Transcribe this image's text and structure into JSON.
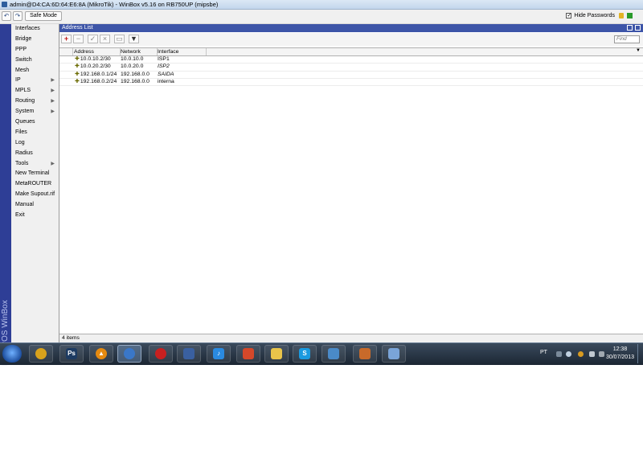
{
  "window": {
    "title": "admin@D4:CA:6D:64:E6:8A (MikroTik) - WinBox v5.16 on RB750UP (mipsbe)"
  },
  "toolbar": {
    "undo_icon": "undo-icon",
    "redo_icon": "redo-icon",
    "safe_mode_label": "Safe Mode",
    "hide_passwords_label": "Hide Passwords",
    "hide_passwords_checked": true
  },
  "sidebar": {
    "brand": "RouterOS WinBox",
    "items": [
      {
        "label": "Interfaces",
        "submenu": false
      },
      {
        "label": "Bridge",
        "submenu": false
      },
      {
        "label": "PPP",
        "submenu": false
      },
      {
        "label": "Switch",
        "submenu": false
      },
      {
        "label": "Mesh",
        "submenu": false
      },
      {
        "label": "IP",
        "submenu": true
      },
      {
        "label": "MPLS",
        "submenu": true
      },
      {
        "label": "Routing",
        "submenu": true
      },
      {
        "label": "System",
        "submenu": true
      },
      {
        "label": "Queues",
        "submenu": false
      },
      {
        "label": "Files",
        "submenu": false
      },
      {
        "label": "Log",
        "submenu": false
      },
      {
        "label": "Radius",
        "submenu": false
      },
      {
        "label": "Tools",
        "submenu": true
      },
      {
        "label": "New Terminal",
        "submenu": false
      },
      {
        "label": "MetaROUTER",
        "submenu": false
      },
      {
        "label": "Make Supout.rif",
        "submenu": false
      },
      {
        "label": "Manual",
        "submenu": false
      },
      {
        "label": "Exit",
        "submenu": false
      }
    ]
  },
  "address_list": {
    "title": "Address List",
    "find_placeholder": "Find",
    "columns": [
      "Address",
      "Network",
      "Interface"
    ],
    "rows": [
      {
        "address": "10.0.10.2/30",
        "network": "10.0.10.0",
        "interface": "ISP1",
        "italic": false
      },
      {
        "address": "10.0.20.2/30",
        "network": "10.0.20.0",
        "interface": "ISP2",
        "italic": true
      },
      {
        "address": "192.168.0.1/24",
        "network": "192.168.0.0",
        "interface": "SAIDA",
        "italic": true
      },
      {
        "address": "192.168.0.2/24",
        "network": "192.168.0.0",
        "interface": "interna",
        "italic": false
      }
    ],
    "status": "4 items"
  },
  "taskbar": {
    "apps": [
      {
        "name": "chrome-icon",
        "glyph": "",
        "color": "#d8a21c"
      },
      {
        "name": "photoshop-icon",
        "glyph": "Ps",
        "color": "#1d3b62"
      },
      {
        "name": "vlc-icon",
        "glyph": "▲",
        "color": "#e58a10"
      },
      {
        "name": "winbox-icon",
        "glyph": "",
        "color": "#3a77c8"
      },
      {
        "name": "recorder-icon",
        "glyph": "",
        "color": "#c82020"
      },
      {
        "name": "network-icon",
        "glyph": "",
        "color": "#3a60a0"
      },
      {
        "name": "itunes-icon",
        "glyph": "♪",
        "color": "#2a8ae0"
      },
      {
        "name": "media-center-icon",
        "glyph": "",
        "color": "#d4482a"
      },
      {
        "name": "folder-icon",
        "glyph": "",
        "color": "#e8c44a"
      },
      {
        "name": "skype-icon",
        "glyph": "S",
        "color": "#1a9ae0"
      },
      {
        "name": "remote-desktop-icon",
        "glyph": "",
        "color": "#4a8ac8"
      },
      {
        "name": "cat-icon",
        "glyph": "",
        "color": "#c86a2a"
      },
      {
        "name": "paint-icon",
        "glyph": "",
        "color": "#7aa4d8"
      }
    ],
    "language": "PT",
    "time": "12:38",
    "date": "30/07/2013"
  },
  "colors": {
    "sidebar_strip": "#2e3e96",
    "window_header": "#3d55a8",
    "add_button": "#c01818"
  }
}
